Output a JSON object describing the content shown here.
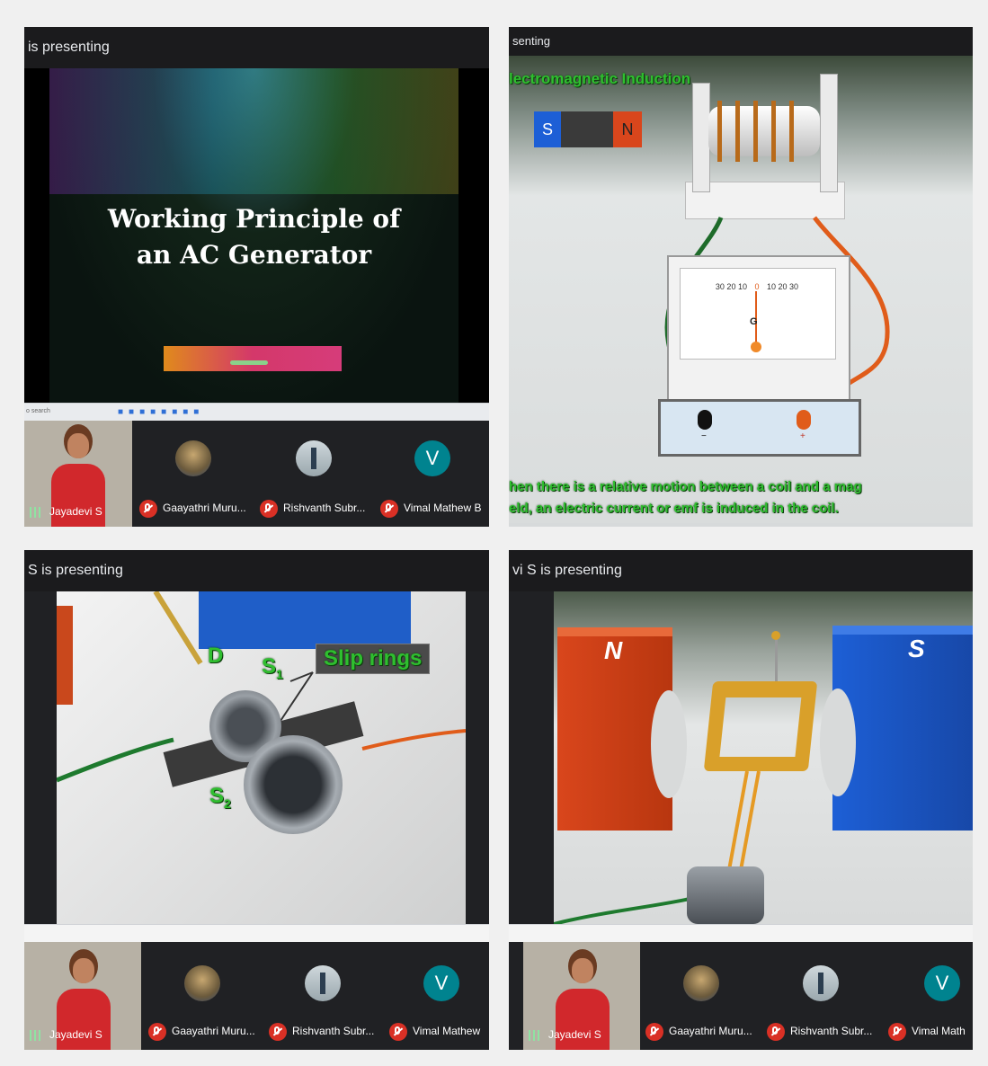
{
  "panels": [
    {
      "presenting_label": "is presenting",
      "slide_title_line1": "Working Principle of",
      "slide_title_line2": "an AC Generator",
      "taskbar_search": "o search",
      "participants": {
        "self_name": "Jayadevi S",
        "p1": "Gaayathri Muru...",
        "p2": "Rishvanth Subr...",
        "p3": "Vimal Mathew B",
        "p3_initial": "V"
      }
    },
    {
      "presenting_label": "senting",
      "slide_heading": "lectromagnetic Induction",
      "magnet_s": "S",
      "magnet_n": "N",
      "galvanometer_letter": "G",
      "scale_left": "30 20 10",
      "scale_zero": "0",
      "scale_right": "10 20 30",
      "terminal_minus": "−",
      "terminal_plus": "+",
      "caption_line1": "hen there is a relative motion between a coil and a mag",
      "caption_line2": "eld, an electric current or emf is induced in the coil."
    },
    {
      "presenting_label": "S is presenting",
      "label_d": "D",
      "label_s1": "S",
      "label_s1_sub": "1",
      "label_s2": "S",
      "label_s2_sub": "2",
      "slip_rings_label": "Slip rings",
      "participants": {
        "self_name": "Jayadevi S",
        "p1": "Gaayathri Muru...",
        "p2": "Rishvanth Subr...",
        "p3": "Vimal Mathew",
        "p3_initial": "V"
      }
    },
    {
      "presenting_label": "vi S is presenting",
      "magnet_n": "N",
      "magnet_s": "S",
      "participants": {
        "self_name": "Jayadevi S",
        "p1": "Gaayathri Muru...",
        "p2": "Rishvanth Subr...",
        "p3": "Vimal Math",
        "p3_initial": "V"
      }
    }
  ],
  "colors": {
    "mute_red": "#d93025",
    "avatar_teal": "#00838f",
    "caption_green": "#2fbf2f",
    "magnet_red": "#d9461c",
    "magnet_blue": "#1d5fd6"
  }
}
